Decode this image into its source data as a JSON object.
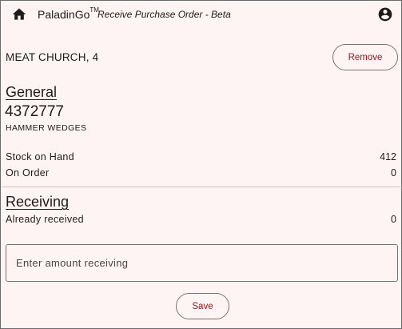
{
  "header": {
    "brand": "PaladinGo",
    "trademark": "TM",
    "subtitle": "Receive Purchase Order - Beta",
    "home_icon": "home-icon",
    "account_icon": "account-circle-icon"
  },
  "product": {
    "name": "MEAT CHURCH, 4",
    "remove_label": "Remove"
  },
  "general": {
    "title": "General",
    "sku": "4372777",
    "description": "HAMMER WEDGES",
    "stock_on_hand_label": "Stock on Hand",
    "stock_on_hand_value": "412",
    "on_order_label": "On Order",
    "on_order_value": "0"
  },
  "receiving": {
    "title": "Receiving",
    "already_received_label": "Already received",
    "already_received_value": "0",
    "amount_placeholder": "Enter amount receiving",
    "amount_value": "",
    "save_label": "Save"
  },
  "colors": {
    "background": "#fdf4f3",
    "accent": "#a0141a",
    "text": "#1f1b1b"
  }
}
